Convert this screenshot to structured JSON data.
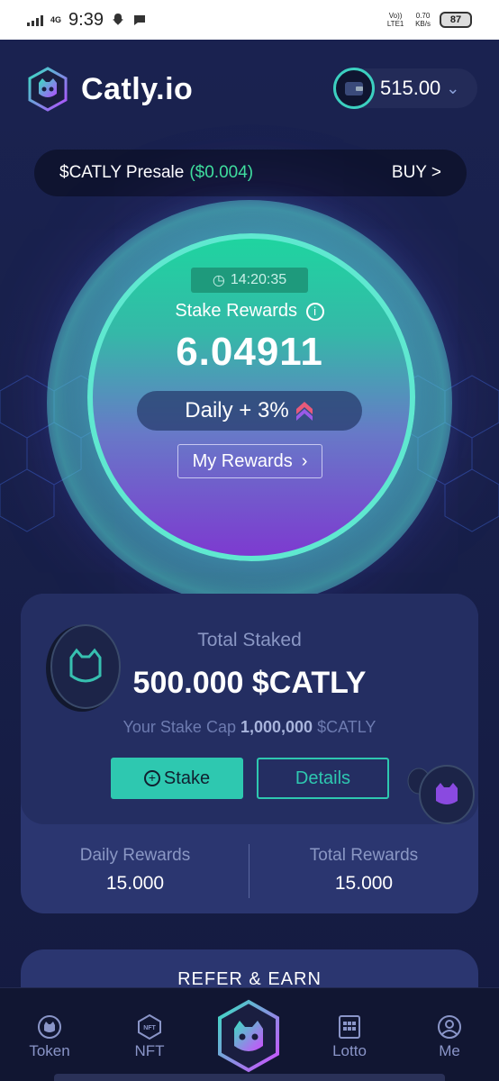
{
  "status_bar": {
    "network": "4G",
    "time": "9:39",
    "volte": "Vo)) LTE1",
    "speed": "0.70",
    "speed_unit": "KB/s",
    "battery": "87"
  },
  "header": {
    "brand": "Catly.io",
    "wallet_balance": "515.00"
  },
  "presale": {
    "label": "$CATLY Presale",
    "price": "($0.004)",
    "buy_label": "BUY >"
  },
  "stake_circle": {
    "timer": "14:20:35",
    "title": "Stake Rewards",
    "value": "6.04911",
    "daily": "Daily + 3%",
    "my_rewards": "My Rewards"
  },
  "stake_card": {
    "total_label": "Total Staked",
    "total_value": "500.000 $CATLY",
    "cap_prefix": "Your Stake Cap",
    "cap_value": "1,000,000",
    "cap_suffix": "$CATLY",
    "stake_button": "Stake",
    "details_button": "Details",
    "daily_rewards_label": "Daily Rewards",
    "daily_rewards_value": "15.000",
    "total_rewards_label": "Total Rewards",
    "total_rewards_value": "15.000"
  },
  "refer": {
    "title": "REFER & EARN"
  },
  "nav": {
    "items": [
      {
        "label": "Token",
        "icon": "cat-token-icon"
      },
      {
        "label": "NFT",
        "icon": "nft-icon"
      },
      {
        "label": "Lotto",
        "icon": "lotto-icon"
      },
      {
        "label": "Me",
        "icon": "user-icon"
      }
    ]
  },
  "colors": {
    "accent": "#2ec8b0",
    "green_price": "#3ee39b",
    "background": "#141a3a",
    "card": "#2b3670"
  }
}
